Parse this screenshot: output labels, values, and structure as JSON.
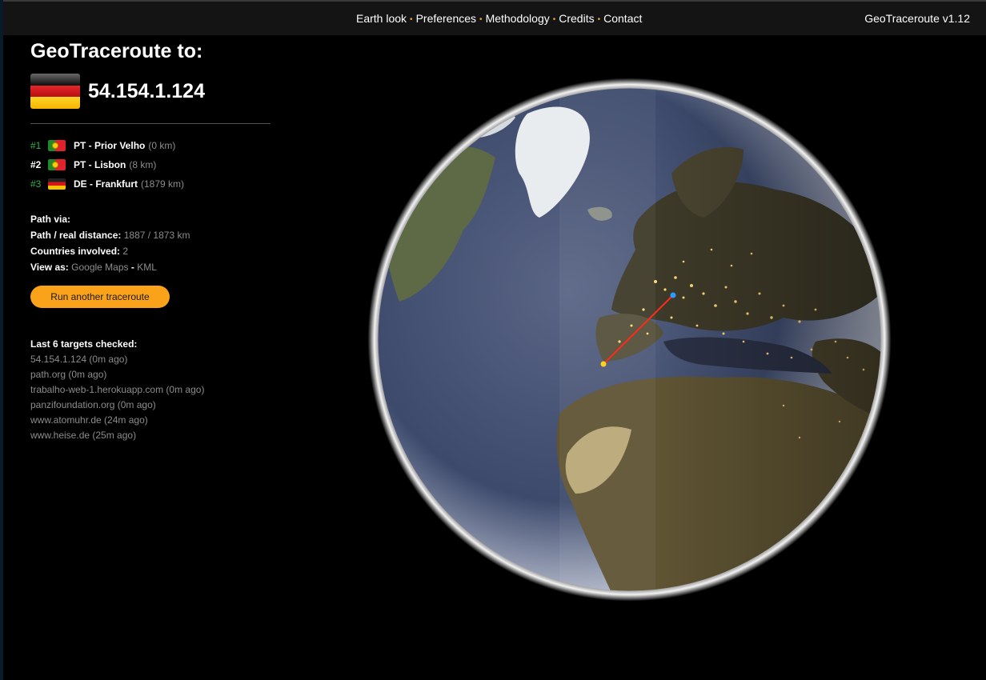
{
  "nav": {
    "items": [
      "Earth look",
      "Preferences",
      "Methodology",
      "Credits",
      "Contact"
    ],
    "separator": "•"
  },
  "app": {
    "version": "GeoTraceroute v1.12"
  },
  "panel": {
    "title": "GeoTraceroute to:",
    "target_ip": "54.154.1.124",
    "target_flag": "DE"
  },
  "hops": [
    {
      "num": "#1",
      "flag": "PT",
      "name": "PT - Prior Velho",
      "dist": "(0 km)"
    },
    {
      "num": "#2",
      "flag": "PT",
      "name": "PT - Lisbon",
      "dist": "(8 km)"
    },
    {
      "num": "#3",
      "flag": "DE",
      "name": "DE - Frankfurt",
      "dist": "(1879 km)"
    }
  ],
  "info": {
    "path_via": "Path via:",
    "distance_label": "Path / real distance:",
    "distance_value": "1887 / 1873 km",
    "countries_label": "Countries involved:",
    "countries_value": "2",
    "view_label": "View as:",
    "view_google": "Google Maps",
    "view_dash": "-",
    "view_kml": "KML"
  },
  "run_button": "Run another traceroute",
  "recent": {
    "heading": "Last 6 targets checked:",
    "items": [
      "54.154.1.124 (0m ago)",
      "path.org (0m ago)",
      "trabalho-web-1.herokuapp.com (0m ago)",
      "panzifoundation.org (0m ago)",
      "www.atomuhr.de (24m ago)",
      "www.heise.de (25m ago)"
    ]
  },
  "colors": {
    "accent": "#f9a21a",
    "hop_green": "#2fb24a",
    "route_line": "#ff2a1a",
    "muted_text": "#8c8c8c"
  }
}
